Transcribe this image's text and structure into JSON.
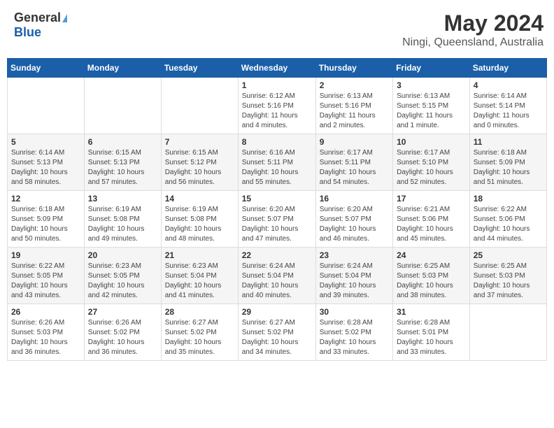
{
  "logo": {
    "general": "General",
    "blue": "Blue"
  },
  "title": {
    "month": "May 2024",
    "location": "Ningi, Queensland, Australia"
  },
  "headers": [
    "Sunday",
    "Monday",
    "Tuesday",
    "Wednesday",
    "Thursday",
    "Friday",
    "Saturday"
  ],
  "weeks": [
    [
      {
        "day": "",
        "info": ""
      },
      {
        "day": "",
        "info": ""
      },
      {
        "day": "",
        "info": ""
      },
      {
        "day": "1",
        "info": "Sunrise: 6:12 AM\nSunset: 5:16 PM\nDaylight: 11 hours\nand 4 minutes."
      },
      {
        "day": "2",
        "info": "Sunrise: 6:13 AM\nSunset: 5:16 PM\nDaylight: 11 hours\nand 2 minutes."
      },
      {
        "day": "3",
        "info": "Sunrise: 6:13 AM\nSunset: 5:15 PM\nDaylight: 11 hours\nand 1 minute."
      },
      {
        "day": "4",
        "info": "Sunrise: 6:14 AM\nSunset: 5:14 PM\nDaylight: 11 hours\nand 0 minutes."
      }
    ],
    [
      {
        "day": "5",
        "info": "Sunrise: 6:14 AM\nSunset: 5:13 PM\nDaylight: 10 hours\nand 58 minutes."
      },
      {
        "day": "6",
        "info": "Sunrise: 6:15 AM\nSunset: 5:13 PM\nDaylight: 10 hours\nand 57 minutes."
      },
      {
        "day": "7",
        "info": "Sunrise: 6:15 AM\nSunset: 5:12 PM\nDaylight: 10 hours\nand 56 minutes."
      },
      {
        "day": "8",
        "info": "Sunrise: 6:16 AM\nSunset: 5:11 PM\nDaylight: 10 hours\nand 55 minutes."
      },
      {
        "day": "9",
        "info": "Sunrise: 6:17 AM\nSunset: 5:11 PM\nDaylight: 10 hours\nand 54 minutes."
      },
      {
        "day": "10",
        "info": "Sunrise: 6:17 AM\nSunset: 5:10 PM\nDaylight: 10 hours\nand 52 minutes."
      },
      {
        "day": "11",
        "info": "Sunrise: 6:18 AM\nSunset: 5:09 PM\nDaylight: 10 hours\nand 51 minutes."
      }
    ],
    [
      {
        "day": "12",
        "info": "Sunrise: 6:18 AM\nSunset: 5:09 PM\nDaylight: 10 hours\nand 50 minutes."
      },
      {
        "day": "13",
        "info": "Sunrise: 6:19 AM\nSunset: 5:08 PM\nDaylight: 10 hours\nand 49 minutes."
      },
      {
        "day": "14",
        "info": "Sunrise: 6:19 AM\nSunset: 5:08 PM\nDaylight: 10 hours\nand 48 minutes."
      },
      {
        "day": "15",
        "info": "Sunrise: 6:20 AM\nSunset: 5:07 PM\nDaylight: 10 hours\nand 47 minutes."
      },
      {
        "day": "16",
        "info": "Sunrise: 6:20 AM\nSunset: 5:07 PM\nDaylight: 10 hours\nand 46 minutes."
      },
      {
        "day": "17",
        "info": "Sunrise: 6:21 AM\nSunset: 5:06 PM\nDaylight: 10 hours\nand 45 minutes."
      },
      {
        "day": "18",
        "info": "Sunrise: 6:22 AM\nSunset: 5:06 PM\nDaylight: 10 hours\nand 44 minutes."
      }
    ],
    [
      {
        "day": "19",
        "info": "Sunrise: 6:22 AM\nSunset: 5:05 PM\nDaylight: 10 hours\nand 43 minutes."
      },
      {
        "day": "20",
        "info": "Sunrise: 6:23 AM\nSunset: 5:05 PM\nDaylight: 10 hours\nand 42 minutes."
      },
      {
        "day": "21",
        "info": "Sunrise: 6:23 AM\nSunset: 5:04 PM\nDaylight: 10 hours\nand 41 minutes."
      },
      {
        "day": "22",
        "info": "Sunrise: 6:24 AM\nSunset: 5:04 PM\nDaylight: 10 hours\nand 40 minutes."
      },
      {
        "day": "23",
        "info": "Sunrise: 6:24 AM\nSunset: 5:04 PM\nDaylight: 10 hours\nand 39 minutes."
      },
      {
        "day": "24",
        "info": "Sunrise: 6:25 AM\nSunset: 5:03 PM\nDaylight: 10 hours\nand 38 minutes."
      },
      {
        "day": "25",
        "info": "Sunrise: 6:25 AM\nSunset: 5:03 PM\nDaylight: 10 hours\nand 37 minutes."
      }
    ],
    [
      {
        "day": "26",
        "info": "Sunrise: 6:26 AM\nSunset: 5:03 PM\nDaylight: 10 hours\nand 36 minutes."
      },
      {
        "day": "27",
        "info": "Sunrise: 6:26 AM\nSunset: 5:02 PM\nDaylight: 10 hours\nand 36 minutes."
      },
      {
        "day": "28",
        "info": "Sunrise: 6:27 AM\nSunset: 5:02 PM\nDaylight: 10 hours\nand 35 minutes."
      },
      {
        "day": "29",
        "info": "Sunrise: 6:27 AM\nSunset: 5:02 PM\nDaylight: 10 hours\nand 34 minutes."
      },
      {
        "day": "30",
        "info": "Sunrise: 6:28 AM\nSunset: 5:02 PM\nDaylight: 10 hours\nand 33 minutes."
      },
      {
        "day": "31",
        "info": "Sunrise: 6:28 AM\nSunset: 5:01 PM\nDaylight: 10 hours\nand 33 minutes."
      },
      {
        "day": "",
        "info": ""
      }
    ]
  ]
}
